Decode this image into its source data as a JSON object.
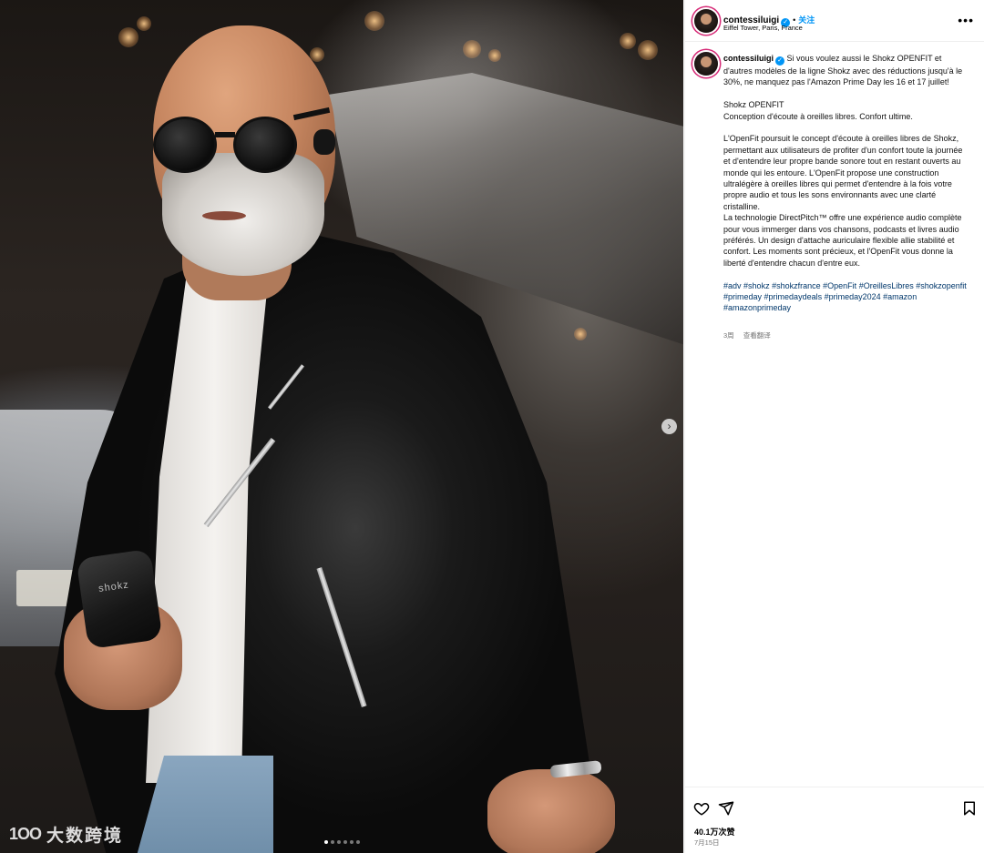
{
  "post": {
    "username": "contessiluigi",
    "verified_mark": "✓",
    "bullet": "•",
    "follow_label": "关注",
    "location": "Eiffel Tower, Paris, France",
    "more_label": "•••"
  },
  "caption": {
    "username": "contessiluigi",
    "intro": "Si vous voulez aussi le Shokz OPENFIT et d'autres modèles de la ligne Shokz avec des réductions jusqu'à le 30%, ne manquez pas l'Amazon Prime Day les 16 et 17 juillet!",
    "product_name": "Shokz OPENFIT",
    "product_tagline": "Conception d'écoute à oreilles libres. Confort ultime.",
    "para1": "L'OpenFit poursuit le concept d'écoute à oreilles libres de Shokz, permettant aux utilisateurs de profiter d'un confort toute la journée et d'entendre leur propre bande sonore tout en restant ouverts au monde qui les entoure. L'OpenFit propose une construction ultralégère à oreilles libres qui permet d'entendre à la fois votre propre audio et tous les sons environnants avec une clarté cristalline.",
    "para2": "La technologie DirectPitch™ offre une expérience audio complète pour vous immerger dans vos chansons, podcasts et livres audio préférés. Un design d'attache auriculaire flexible allie stabilité et confort. Les moments sont précieux, et l'OpenFit vous donne la liberté d'entendre chacun d'entre eux.",
    "hashtags": [
      "#adv",
      "#shokz",
      "#shokzfrance",
      "#OpenFit",
      "#OreillesLibres",
      "#shokzopenfit",
      "#primeday",
      "#primedaydeals",
      "#primeday2024",
      "#amazon",
      "#amazonprimeday"
    ],
    "time_ago": "3周",
    "translate_label": "查看翻译"
  },
  "photo": {
    "case_brand": "shokz",
    "carousel_next_glyph": "›",
    "carousel": {
      "slide_count": 6,
      "active_index": 0
    },
    "watermark_logo": "1OO",
    "watermark_text": "大数跨境"
  },
  "footer": {
    "likes": "40.1万次赞",
    "date": "7月15日"
  },
  "icons": [
    "heart-icon",
    "share-icon",
    "bookmark-icon",
    "more-icon",
    "verified-icon",
    "chevron-right-icon"
  ],
  "colors": {
    "accent_blue": "#0095f6",
    "hashtag_blue": "#00376b",
    "muted_gray": "#737373",
    "story_ring": "#d62976"
  }
}
